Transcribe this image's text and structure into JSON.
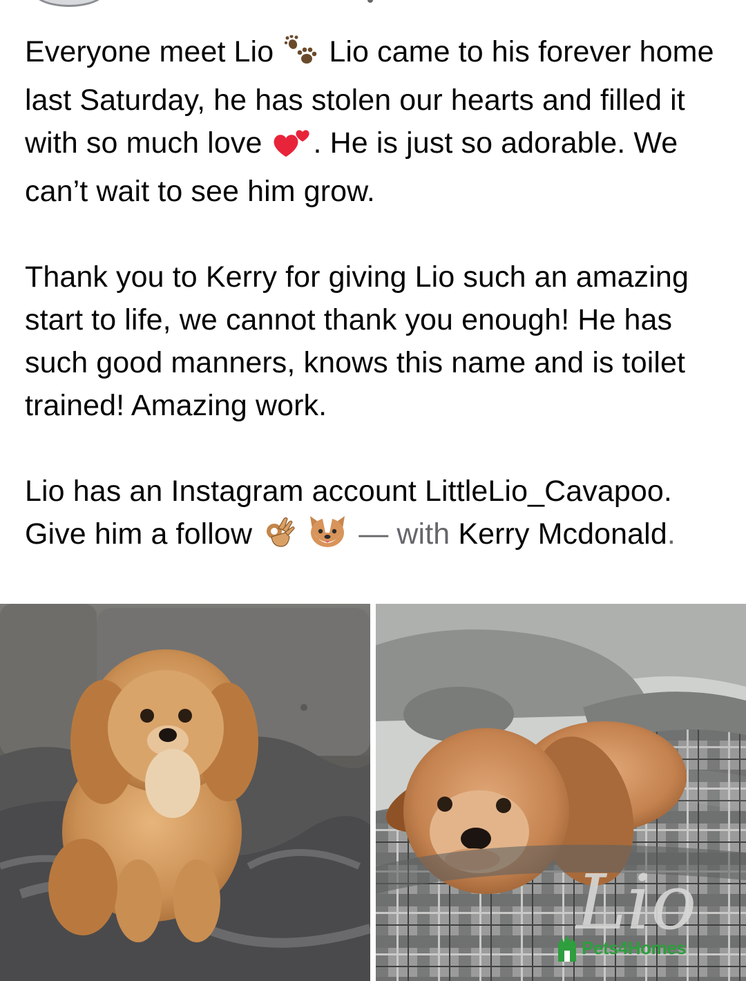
{
  "post": {
    "paragraph1": {
      "part1": "Everyone meet Lio",
      "emoji1": "paw-prints-icon",
      "part2": "Lio came to his forever home last Saturday, he has stolen our hearts and filled it with so much love",
      "emoji2": "two-hearts-icon",
      "part3": ". He is just so adorable. We can’t wait to see him grow."
    },
    "paragraph2": "Thank you to Kerry for giving Lio such an amazing start to life, we cannot thank you enough! He has such good manners, knows this name and is toilet trained! Amazing work.",
    "paragraph3": {
      "part1": "Lio has an Instagram account LittleLio_Cavapoo. Give him a follow",
      "emoji1": "ok-hand-icon",
      "emoji2": "dog-face-icon",
      "dash": "—",
      "with_label": "with",
      "tagged_name": "Kerry Mcdonald",
      "end_period": "."
    }
  },
  "photos": [
    {
      "subject": "puppy sitting on grey sofa with fluffy blanket"
    },
    {
      "subject": "puppy lying in plaid dog bed",
      "bed_text": "Lio"
    }
  ],
  "watermark": {
    "text": "Pets4Homes",
    "color": "#2e9e3e"
  },
  "colors": {
    "text": "#050505",
    "muted": "#65676b",
    "background": "#ffffff"
  }
}
